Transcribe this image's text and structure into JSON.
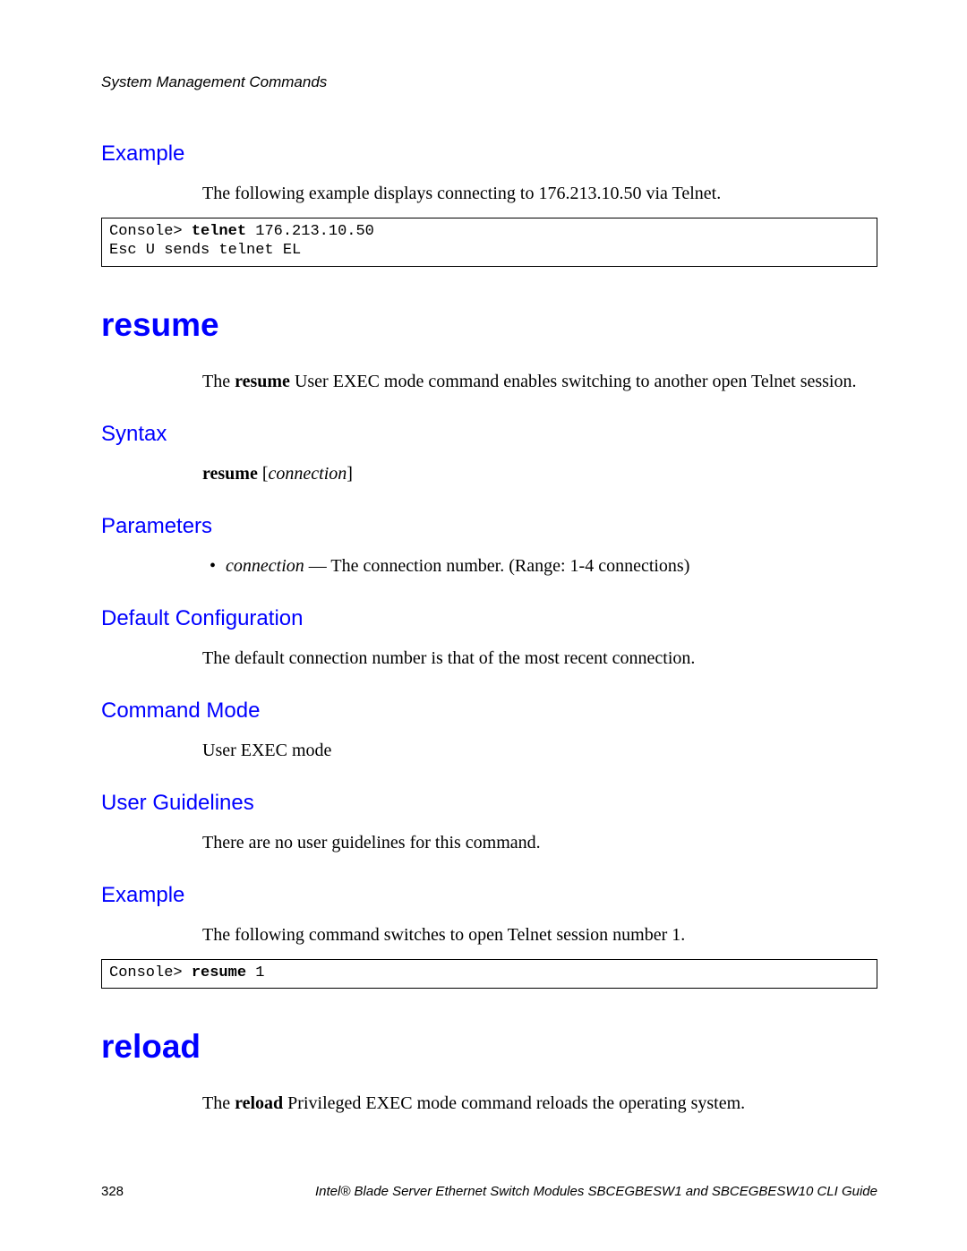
{
  "header": "System Management Commands",
  "example1": {
    "heading": "Example",
    "intro": "The following example displays connecting to 176.213.10.50 via Telnet.",
    "code_prompt": "Console> ",
    "code_cmd": "telnet",
    "code_args": " 176.213.10.50",
    "code_line2": "Esc U sends telnet EL"
  },
  "resume": {
    "title": "resume",
    "desc_pre": "The ",
    "desc_bold": "resume",
    "desc_post": " User EXEC mode command enables switching to another open Telnet session.",
    "syntax_h": "Syntax",
    "syntax_bold": "resume",
    "syntax_rest_open": " [",
    "syntax_rest_it": "connection",
    "syntax_rest_close": "]",
    "params_h": "Parameters",
    "param_it": "connection",
    "param_rest": " — The connection number. (Range: 1-4 connections)",
    "def_h": "Default Configuration",
    "def_text": "The default connection number is that of the most recent connection.",
    "mode_h": "Command Mode",
    "mode_text": "User EXEC mode",
    "ug_h": "User Guidelines",
    "ug_text": "There are no user guidelines for this command.",
    "ex_h": "Example",
    "ex_text": "The following command switches to open Telnet session number 1.",
    "ex_code_prompt": "Console> ",
    "ex_code_cmd": "resume",
    "ex_code_args": " 1"
  },
  "reload": {
    "title": "reload",
    "desc_pre": "The ",
    "desc_bold": "reload",
    "desc_post": " Privileged EXEC mode command reloads the operating system."
  },
  "footer": {
    "page_number": "328",
    "title": "Intel® Blade Server Ethernet Switch Modules SBCEGBESW1 and SBCEGBESW10 CLI Guide"
  }
}
